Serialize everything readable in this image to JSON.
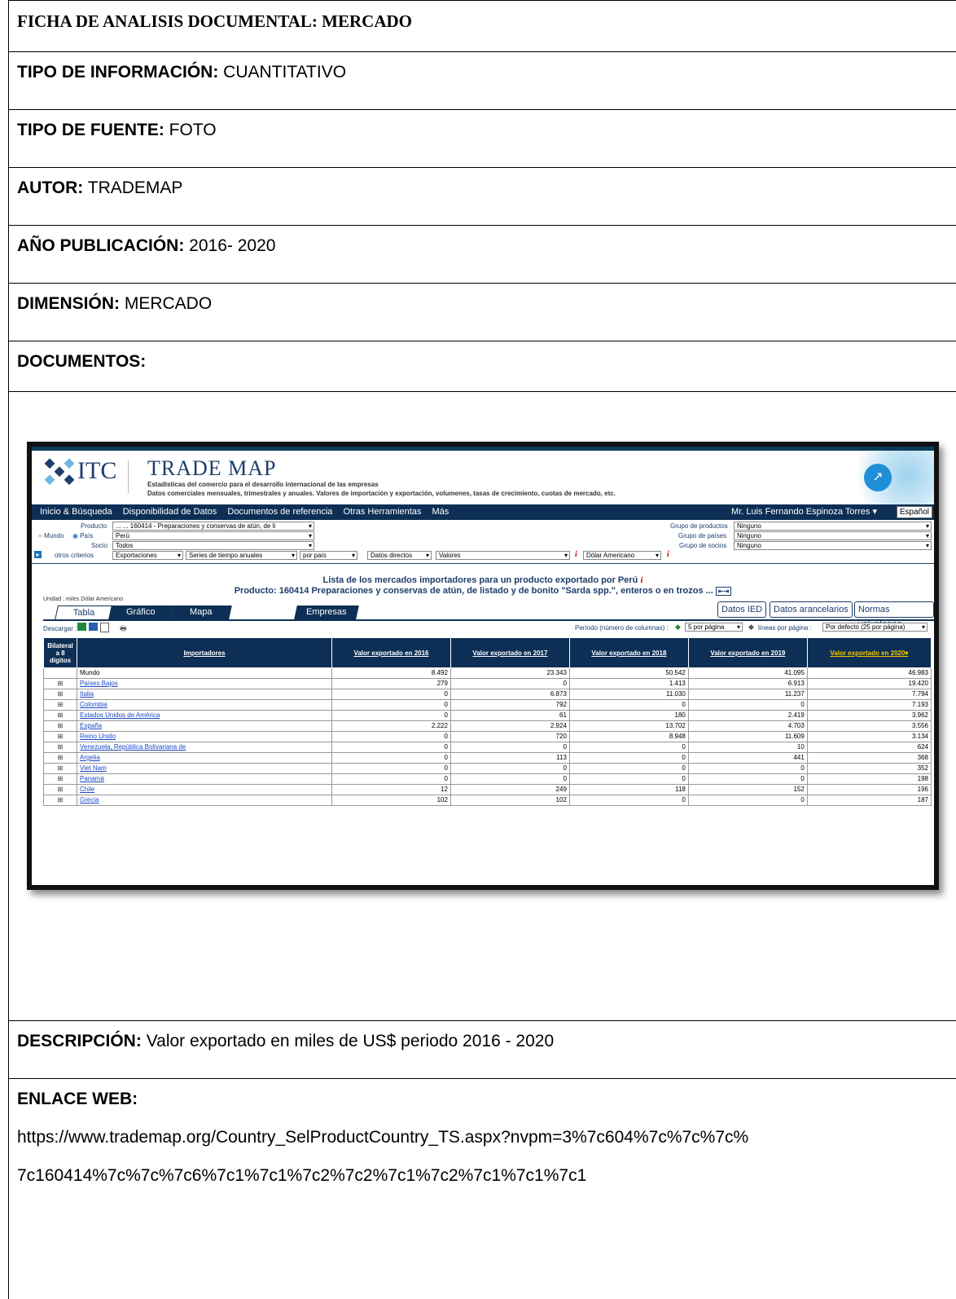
{
  "ficha": {
    "title": "FICHA DE ANALISIS DOCUMENTAL: MERCADO",
    "tipo_info_label": "TIPO DE INFORMACIÓN:",
    "tipo_info_value": " CUANTITATIVO",
    "tipo_fuente_label": "TIPO DE FUENTE:",
    "tipo_fuente_value": " FOTO",
    "autor_label": "AUTOR:",
    "autor_value": " TRADEMAP",
    "anio_label": "AÑO PUBLICACIÓN:",
    "anio_value": " 2016- 2020",
    "dimension_label": "DIMENSIÓN:",
    "dimension_value": " MERCADO",
    "documentos_label": "DOCUMENTOS:",
    "descripcion_label": "DESCRIPCIÓN:",
    "descripcion_value": " Valor exportado en miles de US$ periodo 2016 - 2020",
    "enlace_label": "ENLACE WEB:",
    "enlace_line1": "https://www.trademap.org/Country_SelProductCountry_TS.aspx?nvpm=3%7c604%7c%7c%7c%",
    "enlace_line2": "7c160414%7c%7c%7c6%7c1%7c1%7c2%7c2%7c1%7c2%7c1%7c1%7c1"
  },
  "trademap": {
    "logo_text": "ITC",
    "title": "TRADE MAP",
    "subtitle1": "Estadísticas del comercio para el desarrollo internacional de las empresas",
    "subtitle2": "Datos comerciales mensuales, trimestrales y anuales. Valores de importación y exportación, volumenes, tasas de crecimiento, cuotas de mercado, etc.",
    "nav": [
      "Inicio & Búsqueda",
      "Disponibilidad de Datos",
      "Documentos de referencia",
      "Otras Herramientas",
      "Más"
    ],
    "user": "Mr. Luis Fernando Espinoza Torres ▾",
    "lang": "Español",
    "criteria": {
      "producto_label": "Producto",
      "producto_value": "... ... 160414 - Preparaciones y conservas de atún, de li",
      "mundo_label": "Mundo",
      "pais_label": "País",
      "pais_value": "Perú",
      "socio_label": "Socio",
      "socio_value": "Todos",
      "otros_label": "otros criterios",
      "exportaciones": "Exportaciones",
      "series": "Series de tiempo anuales",
      "por_pais": "por país",
      "datos_directos": "Datos directos",
      "valores": "Valores",
      "moneda": "Dólar Americano",
      "grupo_productos_label": "Grupo de productos",
      "grupo_productos_value": "Ninguno",
      "grupo_paises_label": "Grupo de países",
      "grupo_paises_value": "Ninguno",
      "grupo_socios_label": "Grupo de socios",
      "grupo_socios_value": "Ninguno",
      "info_i": "i"
    },
    "heading1": "Lista de los mercados importadores para un producto exportado por Perú",
    "heading2": "Producto: 160414 Preparaciones y conservas de atún, de listado y de bonito \"Sarda spp.\", enteros o en trozos ...",
    "unit": "Unidad : miles Dólar Americano",
    "tabs": [
      "Tabla",
      "Gráfico",
      "Mapa",
      "Empresas"
    ],
    "right_buttons": [
      "Datos IED",
      "Datos arancelarios",
      "Normas voluntarias"
    ],
    "download_label": "Descargar :",
    "periodo_label": "Período (número de columnas) :",
    "periodo_value": "5 por página",
    "lineas_label": "líneas por página :",
    "lineas_value": "Por defecto (25 por página)",
    "table": {
      "col_first": "Bilateral a 8 dígitos",
      "columns": [
        "Importadores",
        "Valor exportado en 2016",
        "Valor exportado en 2017",
        "Valor exportado en 2018",
        "Valor exportado en 2019",
        "Valor exportado en 2020▾"
      ],
      "rows": [
        {
          "name": "Mundo",
          "v": [
            "8.492",
            "23.343",
            "50.542",
            "41.095",
            "46.983"
          ]
        },
        {
          "name": "Países Bajos",
          "v": [
            "279",
            "0",
            "1.413",
            "6.913",
            "19.420"
          ]
        },
        {
          "name": "Italia",
          "v": [
            "0",
            "6.873",
            "11.030",
            "11.237",
            "7.794"
          ]
        },
        {
          "name": "Colombia",
          "v": [
            "0",
            "792",
            "0",
            "0",
            "7.193"
          ]
        },
        {
          "name": "Estados Unidos de América",
          "v": [
            "0",
            "61",
            "180",
            "2.419",
            "3.962"
          ]
        },
        {
          "name": "España",
          "v": [
            "2.222",
            "2.924",
            "13.702",
            "4.703",
            "3.556"
          ]
        },
        {
          "name": "Reino Unido",
          "v": [
            "0",
            "720",
            "8.948",
            "11.609",
            "3.134"
          ]
        },
        {
          "name": "Venezuela, República Bolivariana de",
          "v": [
            "0",
            "0",
            "0",
            "10",
            "624"
          ]
        },
        {
          "name": "Argelia",
          "v": [
            "0",
            "113",
            "0",
            "441",
            "368"
          ]
        },
        {
          "name": "Viet Nam",
          "v": [
            "0",
            "0",
            "0",
            "0",
            "352"
          ]
        },
        {
          "name": "Panamá",
          "v": [
            "0",
            "0",
            "0",
            "0",
            "198"
          ]
        },
        {
          "name": "Chile",
          "v": [
            "12",
            "249",
            "118",
            "152",
            "196"
          ]
        },
        {
          "name": "Grecia",
          "v": [
            "102",
            "102",
            "0",
            "0",
            "187"
          ]
        }
      ]
    }
  }
}
